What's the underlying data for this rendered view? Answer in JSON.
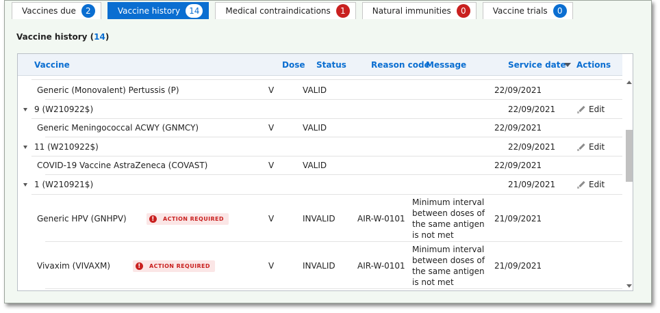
{
  "tabs": [
    {
      "label": "Vaccines due",
      "count": "2",
      "color": "#0a6ed1",
      "active": false
    },
    {
      "label": "Vaccine history",
      "count": "14",
      "color": "#0a6ed1",
      "active": true
    },
    {
      "label": "Medical contraindications",
      "count": "1",
      "color": "#c9201f",
      "active": false
    },
    {
      "label": "Natural immunities",
      "count": "0",
      "color": "#c9201f",
      "active": false
    },
    {
      "label": "Vaccine trials",
      "count": "0",
      "color": "#0a6ed1",
      "active": false
    }
  ],
  "section": {
    "title": "Vaccine history",
    "count": "14"
  },
  "table": {
    "columns": [
      "Vaccine",
      "Dose",
      "Status",
      "Reason code",
      "Message",
      "Service date",
      "Actions"
    ],
    "edit_label": "Edit",
    "action_required_label": "ACTION REQUIRED",
    "rows": [
      {
        "type": "child",
        "vaccine": "Generic (Monovalent) Pertussis (P)",
        "dose": "V",
        "status": "VALID",
        "reason": "",
        "message": "",
        "date": "22/09/2021"
      },
      {
        "type": "group",
        "vaccine": "9 (W210922$)",
        "date": "22/09/2021"
      },
      {
        "type": "child",
        "vaccine": "Generic Meningococcal ACWY (GNMCY)",
        "dose": "V",
        "status": "VALID",
        "reason": "",
        "message": "",
        "date": "22/09/2021"
      },
      {
        "type": "group",
        "vaccine": "11 (W210922$)",
        "date": "22/09/2021"
      },
      {
        "type": "child",
        "vaccine": "COVID-19 Vaccine AstraZeneca (COVAST)",
        "dose": "V",
        "status": "VALID",
        "reason": "",
        "message": "",
        "date": "22/09/2021"
      },
      {
        "type": "group",
        "vaccine": "1 (W210921$)",
        "date": "21/09/2021"
      },
      {
        "type": "child",
        "vaccine": "Generic HPV (GNHPV)",
        "action_required": true,
        "dose": "V",
        "status": "INVALID",
        "reason": "AIR-W-0101",
        "message": "Minimum interval between doses of the same antigen is not met",
        "date": "21/09/2021"
      },
      {
        "type": "child",
        "vaccine": "Vivaxim (VIVAXM)",
        "action_required": true,
        "dose": "V",
        "status": "INVALID",
        "reason": "AIR-W-0101",
        "message": "Minimum interval between doses of the same antigen is not met",
        "date": "21/09/2021"
      }
    ]
  }
}
